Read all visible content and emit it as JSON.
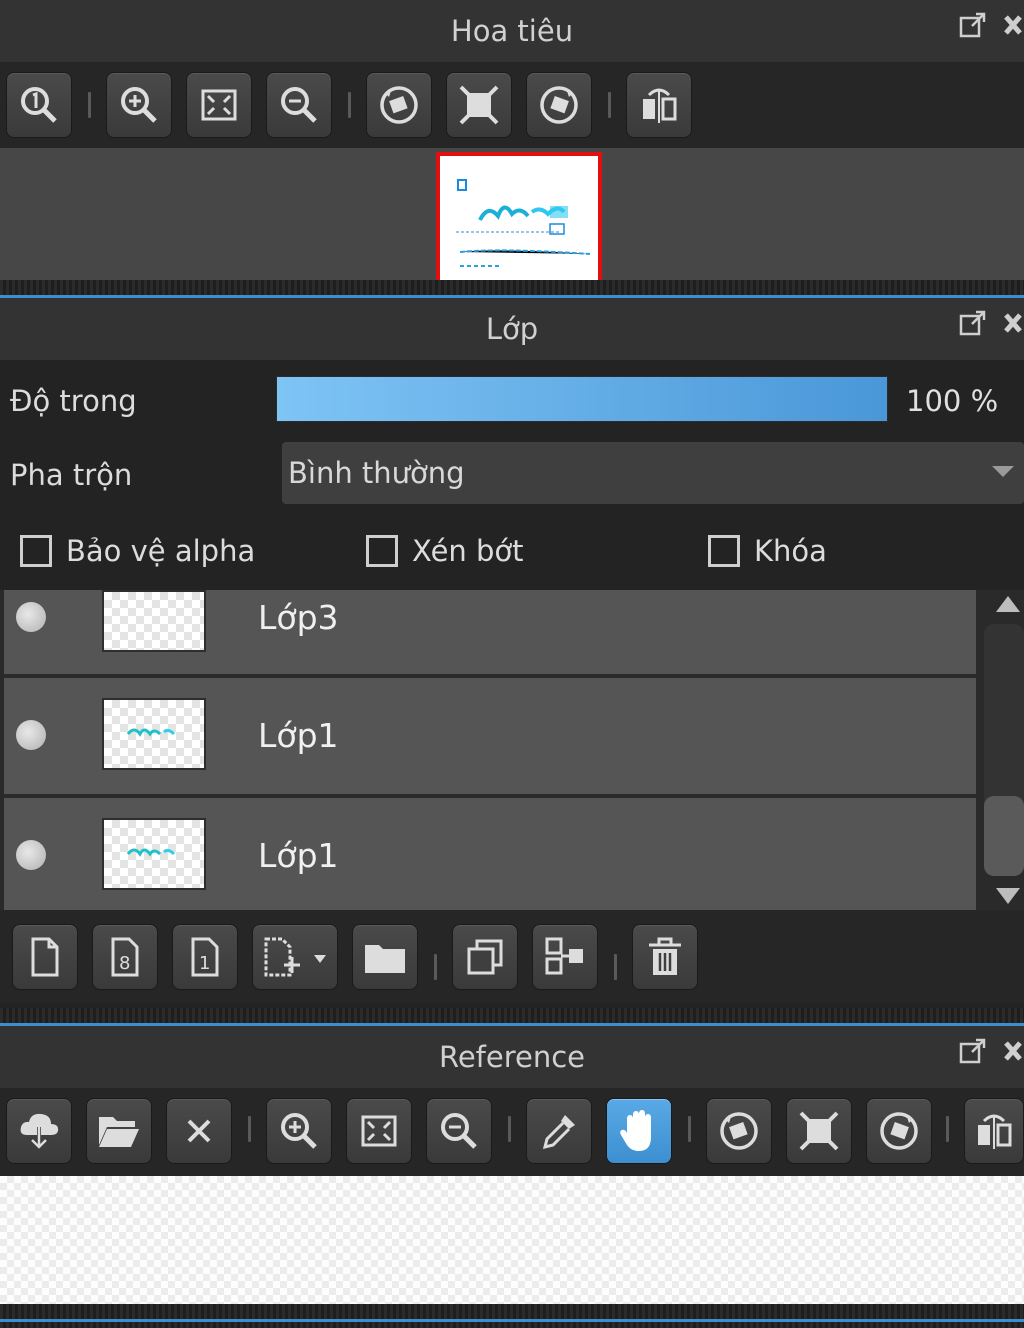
{
  "navigator": {
    "title": "Hoa tiêu",
    "tools": [
      "actual-size-icon",
      "zoom-in-icon",
      "fit-screen-icon",
      "zoom-out-icon",
      "rotate-left-icon",
      "reset-view-icon",
      "rotate-right-icon",
      "flip-horizontal-icon"
    ]
  },
  "layers_panel": {
    "title": "Lớp",
    "opacity_label": "Độ trong",
    "opacity_value": "100 %",
    "opacity_fraction": 1.0,
    "blend_label": "Pha trộn",
    "blend_value": "Bình thường",
    "protect_alpha": "Bảo vệ alpha",
    "clipping": "Xén bớt",
    "lock": "Khóa",
    "layers": [
      {
        "name": "Lớp3"
      },
      {
        "name": "Lớp1"
      },
      {
        "name": "Lớp1"
      }
    ]
  },
  "reference": {
    "title": "Reference"
  },
  "colors": {
    "accent": "#3e8fd0",
    "panel_bg": "#232323",
    "title_bg": "#333333"
  }
}
